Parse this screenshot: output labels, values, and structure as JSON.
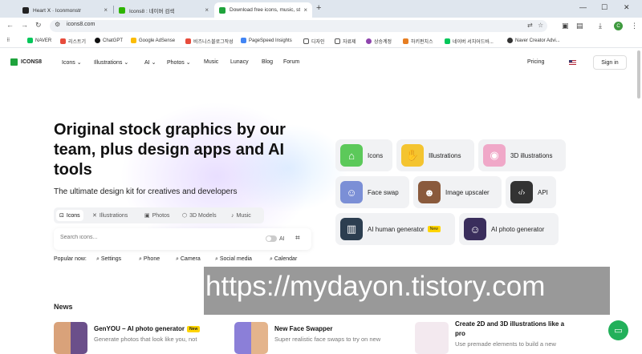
{
  "browser": {
    "tabs": [
      {
        "title": "Heart Ⅹ · Iconmonstr"
      },
      {
        "title": "Icons8 : 네이버 검색"
      },
      {
        "title": "Download free icons, music, st"
      }
    ],
    "new_tab": "+",
    "window_controls": [
      "—",
      "☐",
      "✕"
    ],
    "url": "icons8.com",
    "avatar_letter": "C",
    "bookmarks": [
      "NAVER",
      "리스트기",
      "ChatGPT",
      "Google AdSense",
      "비즈니스블로그작성",
      "PageSpeed Insights",
      "디자인",
      "자료제",
      "상승계정",
      "하키펀치스",
      "네이버 서치어드바...",
      "Naver Creator Advi..."
    ]
  },
  "site": {
    "brand": "ICONS8",
    "nav": [
      "Icons",
      "Illustrations",
      "AI",
      "Photos",
      "Music",
      "Lunacy",
      "Blog",
      "Forum"
    ],
    "nav_dropdown_markers": [
      "⌄",
      "⌄",
      "⌄",
      "⌄"
    ],
    "pricing": "Pricing",
    "signin": "Sign in"
  },
  "hero": {
    "title": "Original stock graphics by our team, plus design apps and AI tools",
    "subtitle": "The ultimate design kit for creatives and developers",
    "type_tabs": [
      {
        "label": "Icons",
        "icon": "⊡"
      },
      {
        "label": "Illustrations",
        "icon": "✕"
      },
      {
        "label": "Photos",
        "icon": "▣"
      },
      {
        "label": "3D Models",
        "icon": "⬡"
      },
      {
        "label": "Music",
        "icon": "♪"
      }
    ],
    "search_placeholder": "Search icons...",
    "ai_label": "AI",
    "popular_label": "Popular now:",
    "popular": [
      "Settings",
      "Phone",
      "Camera",
      "Social media",
      "Calendar"
    ]
  },
  "categories": [
    {
      "label": "Icons",
      "glyph": "⌂",
      "color": "#5cc95a"
    },
    {
      "label": "Illustrations",
      "glyph": "✋",
      "color": "#f4c430"
    },
    {
      "label": "3D illustrations",
      "glyph": "◉",
      "color": "#f0a8c8"
    },
    {
      "label": "Face swap",
      "glyph": "☺",
      "color": "#7b8fd6"
    },
    {
      "label": "Image upscaler",
      "glyph": "☻",
      "color": "#8a5a3c"
    },
    {
      "label": "API",
      "glyph": "‹/›",
      "color": "#333333"
    },
    {
      "label": "AI human generator",
      "glyph": "▥",
      "color": "#2c3e50",
      "badge": "New"
    },
    {
      "label": "AI photo generator",
      "glyph": "☺",
      "color": "#3a2e5c"
    }
  ],
  "news": {
    "heading": "News",
    "items": [
      {
        "title": "GenYOU – AI photo generator",
        "badge": "New",
        "desc": "Generate photos that look like you, not"
      },
      {
        "title": "New Face Swapper",
        "desc": "Super realistic face swaps to try on new"
      },
      {
        "title": "Create 2D and 3D illustrations like a",
        "title2": "pro",
        "desc": "Use premade elements to build a new"
      }
    ]
  },
  "watermark": "https://mydayon.tistory.com",
  "colors": {
    "brand": "#1fa33c",
    "badge": "#ffd400",
    "chat": "#22b05a"
  }
}
